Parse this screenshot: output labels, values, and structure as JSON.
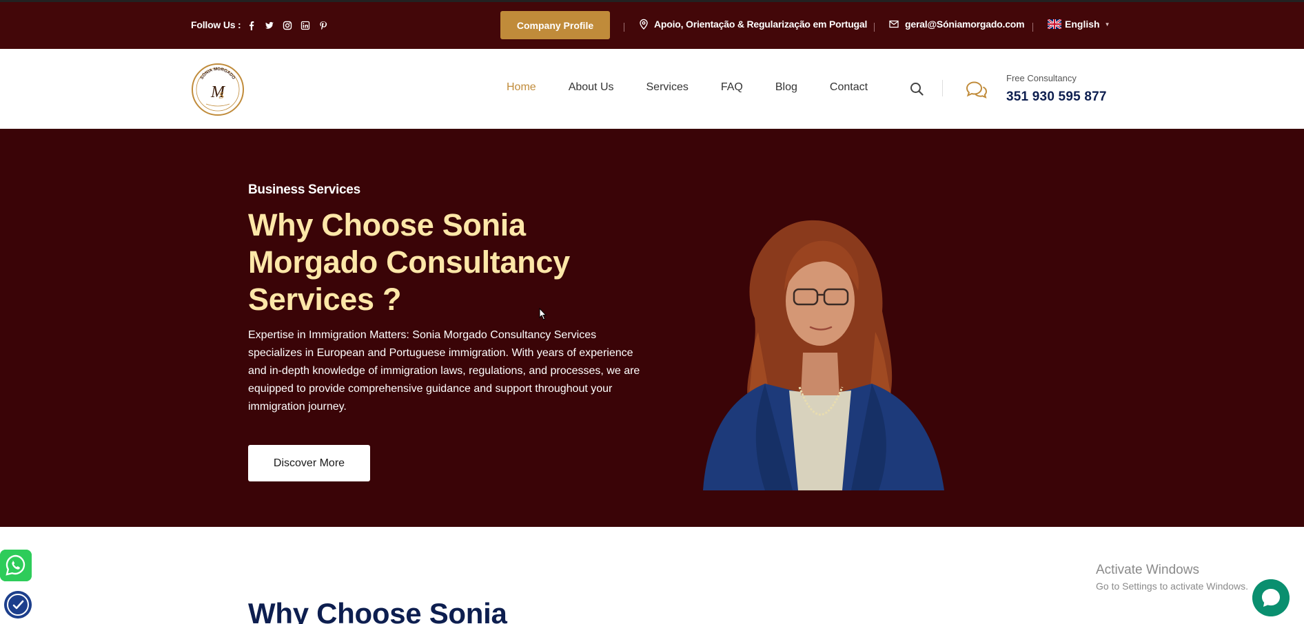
{
  "topbar": {
    "follow_label": "Follow Us :",
    "socials": [
      "facebook-icon",
      "twitter-icon",
      "instagram-icon",
      "linkedin-icon",
      "pinterest-icon"
    ],
    "profile_button": "Company Profile",
    "address": "Apoio, Orientação & Regularização em Portugal",
    "email": "geral@Sóniamorgado.com",
    "language": "English"
  },
  "header": {
    "logo_text": "SÓNIA MORGADO",
    "nav": [
      "Home",
      "About Us",
      "Services",
      "FAQ",
      "Blog",
      "Contact"
    ],
    "active_nav": "Home",
    "consultancy_label": "Free Consultancy",
    "phone": "351 930 595 877"
  },
  "hero": {
    "eyebrow": "Business Services",
    "title": "Why Choose Sonia Morgado Consultancy Services ?",
    "text": "Expertise in Immigration Matters: Sonia Morgado Consultancy Services specializes in European and Portuguese immigration. With years of experience and in-depth knowledge of immigration laws, regulations, and processes, we are equipped to provide comprehensive guidance and support throughout your immigration journey.",
    "button": "Discover More"
  },
  "lower": {
    "title": "Why Choose Sonia"
  },
  "windows_watermark": {
    "line1": "Activate Windows",
    "line2": "Go to Settings to activate Windows."
  },
  "colors": {
    "topbar_bg": "#430709",
    "hero_bg": "#3a0407",
    "accent_gold": "#c08b3a",
    "title_cream": "#fde7a8",
    "navy": "#0d1e4f"
  }
}
